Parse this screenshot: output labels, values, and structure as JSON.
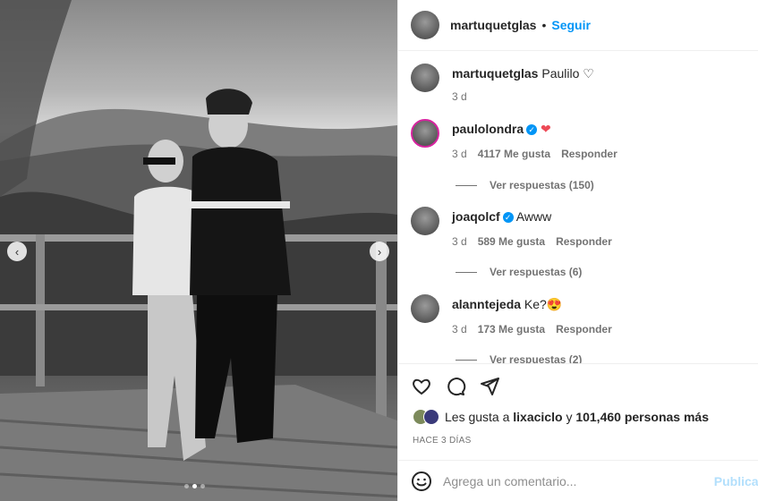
{
  "post": {
    "username": "martuquetglas",
    "separator": "•",
    "follow_label": "Seguir",
    "caption_user": "martuquetglas",
    "caption_text": "Paulilo",
    "caption_time": "3 d"
  },
  "comments": [
    {
      "user": "paulolondra",
      "verified": true,
      "text": "",
      "emoji": "❤",
      "time": "3 d",
      "likes": "4117 Me gusta",
      "reply": "Responder",
      "replies": "Ver respuestas (150)"
    },
    {
      "user": "joaqolcf",
      "verified": true,
      "text": "Awww",
      "emoji": "",
      "time": "3 d",
      "likes": "589 Me gusta",
      "reply": "Responder",
      "replies": "Ver respuestas (6)"
    },
    {
      "user": "alanntejeda",
      "verified": false,
      "text": "Ke?",
      "emoji": "😍",
      "time": "3 d",
      "likes": "173 Me gusta",
      "reply": "Responder",
      "replies": "Ver respuestas (2)"
    }
  ],
  "likes": {
    "prefix": "Les gusta a",
    "user": "lixaciclo",
    "middle": "y",
    "count": "101,460 personas más"
  },
  "posted_ago": "HACE 3 DÍAS",
  "add_comment": {
    "placeholder": "Agrega un comentario...",
    "post_label": "Publicar"
  },
  "carousel": {
    "total": 3,
    "active": 1
  }
}
